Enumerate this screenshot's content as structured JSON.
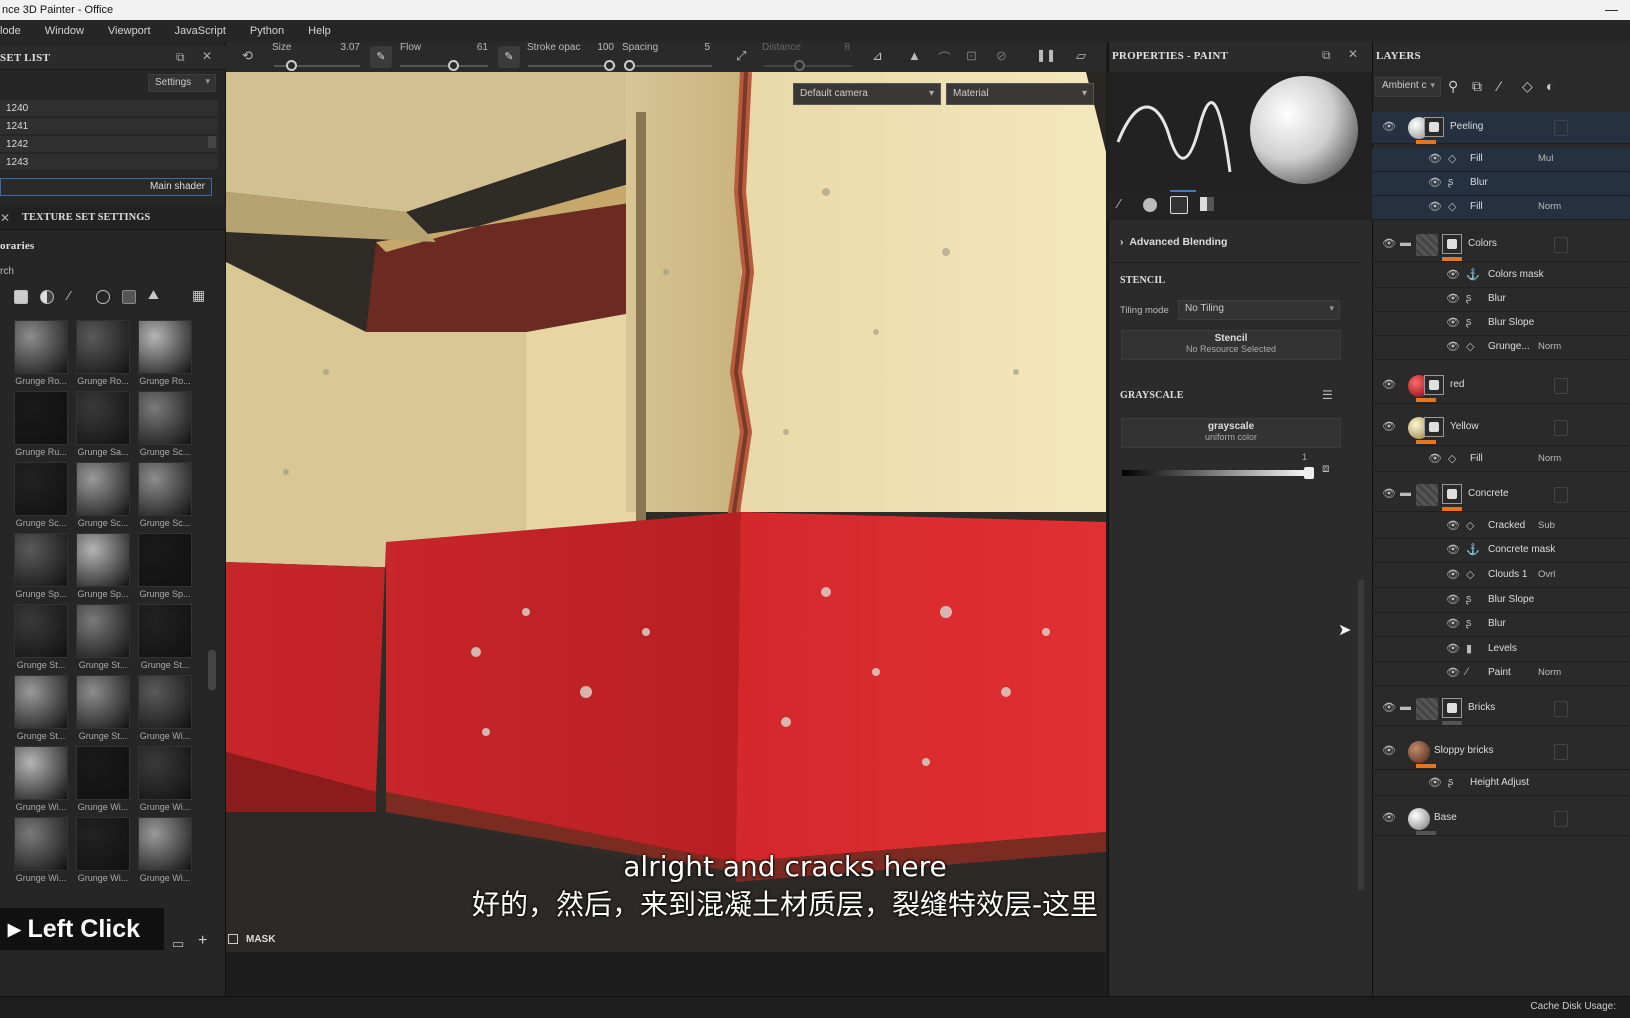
{
  "window": {
    "title": "nce 3D Painter - Office"
  },
  "menu": [
    "lode",
    "Window",
    "Viewport",
    "JavaScript",
    "Python",
    "Help"
  ],
  "texture_set_list": {
    "title": "SET LIST",
    "settings_label": "Settings",
    "rows": [
      "1240",
      "1241",
      "1242",
      "1243"
    ],
    "main_shader": "Main shader"
  },
  "tabs": {
    "texture_set_settings": "TEXTURE SET SETTINGS"
  },
  "shelf": {
    "libraries_label": "oraries",
    "search_label": "rch",
    "thumbs": [
      [
        "Grunge Ro...",
        "Grunge Ro...",
        "Grunge Ro..."
      ],
      [
        "Grunge Ru...",
        "Grunge Sa...",
        "Grunge Sc..."
      ],
      [
        "Grunge Sc...",
        "Grunge Sc...",
        "Grunge Sc..."
      ],
      [
        "Grunge Sp...",
        "Grunge Sp...",
        "Grunge Sp..."
      ],
      [
        "Grunge St...",
        "Grunge St...",
        "Grunge St..."
      ],
      [
        "Grunge St...",
        "Grunge St...",
        "Grunge Wi..."
      ],
      [
        "Grunge Wi...",
        "Grunge Wi...",
        "Grunge Wi..."
      ],
      [
        "Grunge Wi...",
        "Grunge Wi...",
        "Grunge Wi..."
      ]
    ]
  },
  "overlay": {
    "left_click": "Left Click"
  },
  "toolbar": {
    "size_label": "Size",
    "size_value": "3.07",
    "flow_label": "Flow",
    "flow_value": "61",
    "stroke_label": "Stroke opac",
    "stroke_value": "100",
    "spacing_label": "Spacing",
    "spacing_value": "5",
    "distance_label": "Distance",
    "distance_value": "8"
  },
  "viewport": {
    "camera": "Default camera",
    "mode": "Material",
    "mask_label": "MASK"
  },
  "subtitles": {
    "en": "alright and cracks here",
    "zh": "好的，然后，来到混凝土材质层，裂缝特效层-这里"
  },
  "properties": {
    "title": "PROPERTIES - PAINT",
    "advanced_blending": "Advanced Blending",
    "stencil_header": "STENCIL",
    "tiling_label": "Tiling mode",
    "tiling_value": "No Tiling",
    "stencil_title": "Stencil",
    "stencil_sub": "No Resource Selected",
    "grayscale_header": "GRAYSCALE",
    "grayscale_title": "grayscale",
    "grayscale_sub": "uniform color",
    "grayscale_value": "1"
  },
  "layers": {
    "title": "LAYERS",
    "channel": "Ambient c",
    "items": [
      {
        "name": "Peeling"
      },
      {
        "name": "Fill",
        "blend": "Mul"
      },
      {
        "name": "Blur",
        "blend": ""
      },
      {
        "name": "Fill",
        "blend": "Norm"
      },
      {
        "name": "Colors"
      },
      {
        "name": "Colors mask",
        "blend": ""
      },
      {
        "name": "Blur",
        "blend": ""
      },
      {
        "name": "Blur Slope",
        "blend": ""
      },
      {
        "name": "Grunge...",
        "blend": "Norm"
      },
      {
        "name": "red"
      },
      {
        "name": "Yellow"
      },
      {
        "name": "Fill",
        "blend": "Norm"
      },
      {
        "name": "Concrete"
      },
      {
        "name": "Cracked",
        "blend": "Sub"
      },
      {
        "name": "Concrete mask",
        "blend": ""
      },
      {
        "name": "Clouds 1",
        "blend": "Ovrl"
      },
      {
        "name": "Blur Slope",
        "blend": ""
      },
      {
        "name": "Blur",
        "blend": ""
      },
      {
        "name": "Levels",
        "blend": ""
      },
      {
        "name": "Paint",
        "blend": "Norm"
      },
      {
        "name": "Bricks"
      },
      {
        "name": "Sloppy bricks"
      },
      {
        "name": "Height Adjust",
        "blend": ""
      },
      {
        "name": "Base"
      }
    ]
  },
  "status": {
    "cache": "Cache Disk Usage:"
  }
}
